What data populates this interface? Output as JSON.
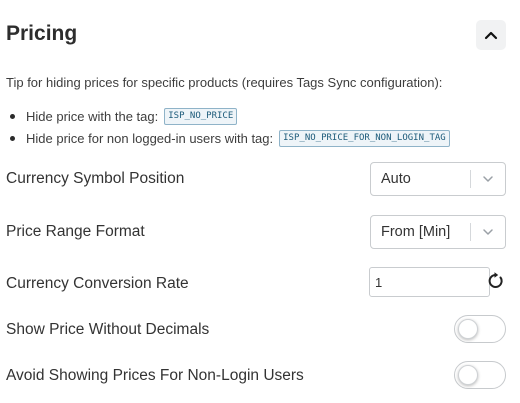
{
  "section": {
    "title": "Pricing",
    "collapse_icon": "chevron-up-icon"
  },
  "tip": {
    "text": "Tip for hiding prices for specific products (requires Tags Sync configuration):",
    "items": [
      {
        "text": "Hide price with the tag:",
        "tag": "ISP_NO_PRICE"
      },
      {
        "text": "Hide price for non logged-in users with tag:",
        "tag": "ISP_NO_PRICE_FOR_NON_LOGIN_TAG"
      }
    ]
  },
  "settings": {
    "currency_symbol_position": {
      "label": "Currency Symbol Position",
      "value": "Auto"
    },
    "price_range_format": {
      "label": "Price Range Format",
      "value": "From [Min]"
    },
    "currency_conversion_rate": {
      "label": "Currency Conversion Rate",
      "value": "1",
      "reset_icon": "reset-icon"
    },
    "show_price_without_decimals": {
      "label": "Show Price Without Decimals",
      "enabled": false
    },
    "avoid_showing_prices_non_login": {
      "label": "Avoid Showing Prices For Non-Login Users",
      "enabled": false
    }
  },
  "colors": {
    "tag_text": "#1d5b7a",
    "tag_border": "#8fb3c8",
    "collapse_button_bg": "#f1f2f3"
  }
}
